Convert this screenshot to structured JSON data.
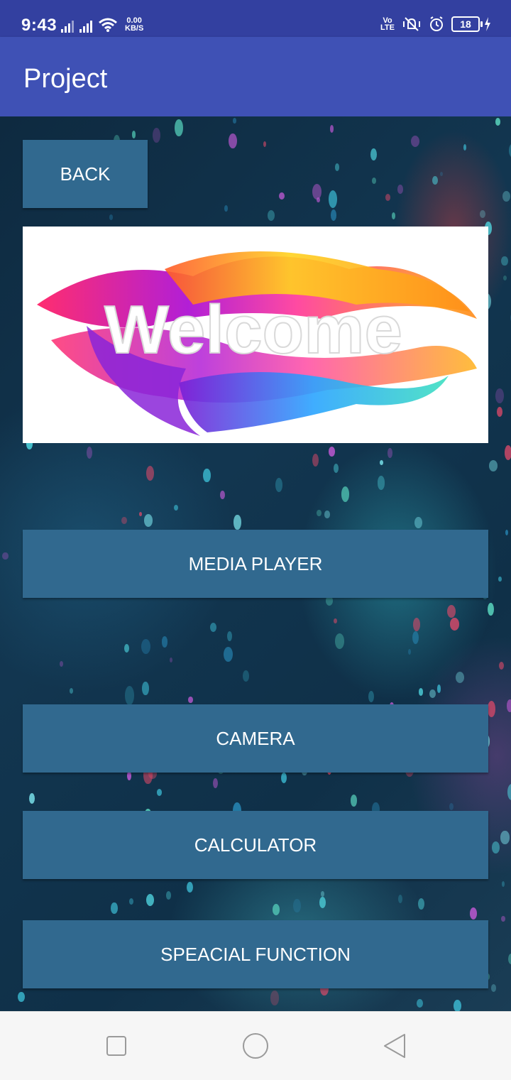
{
  "status_bar": {
    "time": "9:43",
    "net_speed_value": "0.00",
    "net_speed_unit": "KB/S",
    "volte_top": "Vo",
    "volte_bottom": "LTE",
    "battery_level": "18"
  },
  "app_bar": {
    "title": "Project"
  },
  "buttons": {
    "back": "BACK",
    "media_player": "MEDIA PLAYER",
    "camera": "CAMERA",
    "calculator": "CALCULATOR",
    "special_function": "SPEACIAL FUNCTION"
  },
  "welcome_image": {
    "text": "Welcome"
  },
  "nav_bar": {
    "icons": [
      "recents-square-icon",
      "home-circle-icon",
      "back-triangle-icon"
    ]
  },
  "colors": {
    "status_bar": "#3340a0",
    "app_bar": "#3f51b5",
    "button": "#31698f",
    "nav_bar": "#f6f6f6"
  }
}
